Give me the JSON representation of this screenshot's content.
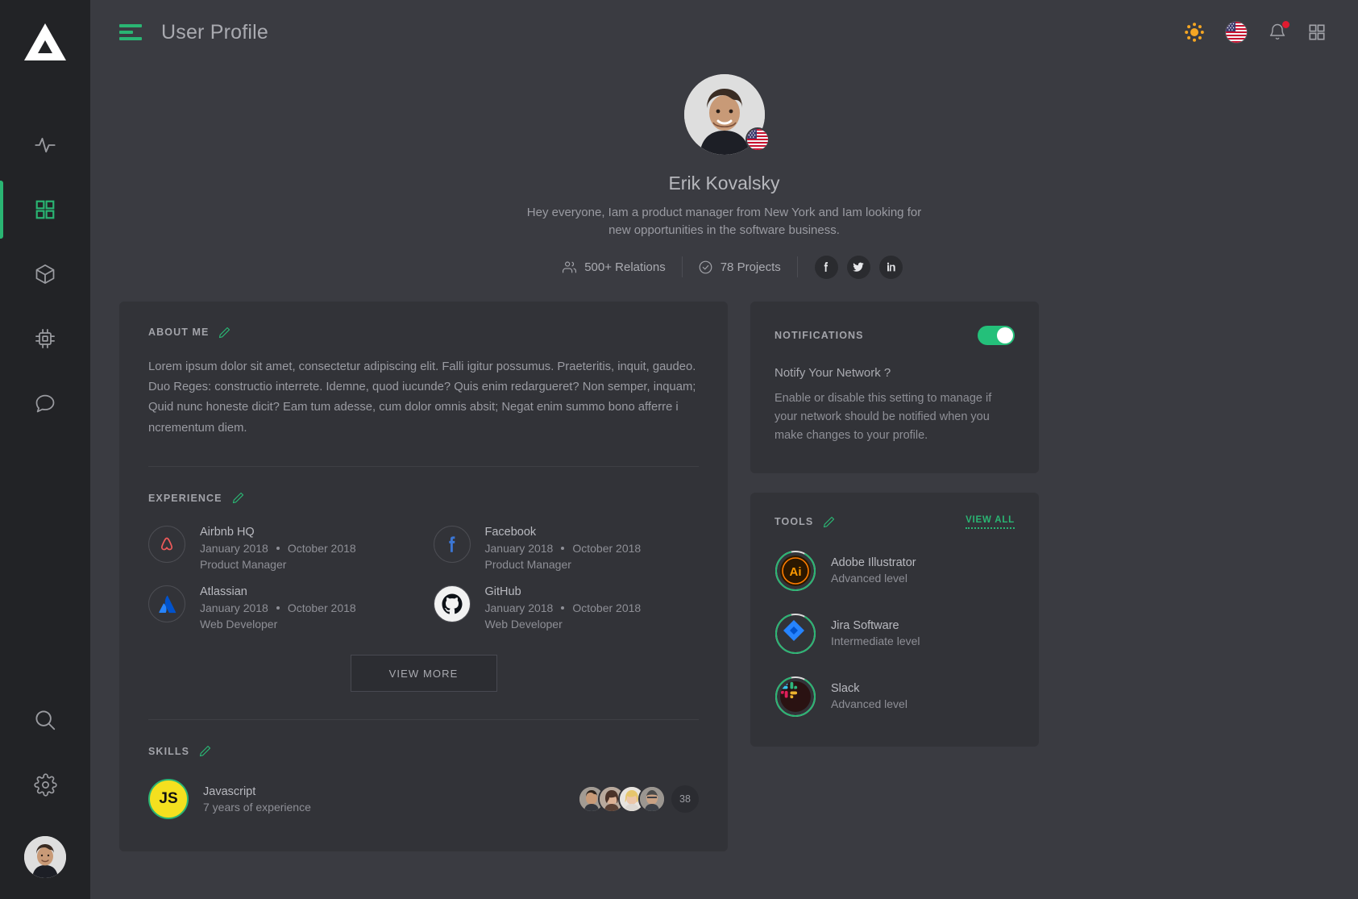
{
  "colors": {
    "accent": "#2ab573",
    "toggle_on": "#24c07a",
    "bg": "#3a3b41",
    "card": "#323338",
    "sidebar": "#222326",
    "notif_dot": "#e01b30",
    "sun": "#f5a623",
    "js_yellow": "#f4e01f"
  },
  "sidebar": {
    "logo_name": "triangle-logo",
    "items": [
      {
        "id": "activity",
        "icon": "activity-pulse-icon",
        "active": false
      },
      {
        "id": "dashboard",
        "icon": "grid-icon",
        "active": true
      },
      {
        "id": "packages",
        "icon": "cube-icon",
        "active": false
      },
      {
        "id": "hardware",
        "icon": "cpu-chip-icon",
        "active": false
      },
      {
        "id": "messages",
        "icon": "chat-bubble-icon",
        "active": false
      }
    ],
    "bottom_items": [
      {
        "id": "search",
        "icon": "search-icon"
      },
      {
        "id": "settings",
        "icon": "gear-icon"
      }
    ],
    "avatar_name": "sidebar-user-avatar"
  },
  "topbar": {
    "menu_icon": "hamburger-menu-icon",
    "title": "User Profile",
    "theme_icon": "sun-icon",
    "language_icon": "us-flag-icon",
    "notifications_icon": "bell-icon",
    "apps_icon": "apps-grid-icon",
    "has_notification": true
  },
  "profile": {
    "avatar_name": "profile-avatar",
    "country_flag": "us-flag-badge",
    "name": "Erik Kovalsky",
    "bio": "Hey everyone,  Iam a product manager from New York and Iam looking for new opportunities in the software business.",
    "stats": [
      {
        "icon": "users-icon",
        "label": "500+ Relations"
      },
      {
        "icon": "check-circle-icon",
        "label": "78 Projects"
      }
    ],
    "socials": [
      {
        "id": "facebook",
        "icon": "facebook-icon"
      },
      {
        "id": "twitter",
        "icon": "twitter-icon"
      },
      {
        "id": "linkedin",
        "icon": "linkedin-icon"
      }
    ]
  },
  "about": {
    "title": "ABOUT ME",
    "edit_icon": "pencil-edit-icon",
    "text": "Lorem ipsum dolor sit amet, consectetur adipiscing elit. Falli igitur possumus. Praeteritis, inquit, gaudeo. Duo Reges: constructio interrete. Idemne, quod iucunde? Quis enim redargueret? Non semper, inquam; Quid nunc honeste dicit? Eam tum adesse, cum dolor omnis absit; Negat enim summo bono afferre i ncrementum diem."
  },
  "experience": {
    "title": "EXPERIENCE",
    "edit_icon": "pencil-edit-icon",
    "items": [
      {
        "company": "Airbnb HQ",
        "logo": "airbnb-icon",
        "start": "January 2018",
        "end": "October 2018",
        "role": "Product Manager"
      },
      {
        "company": "Facebook",
        "logo": "facebook-icon",
        "start": "January 2018",
        "end": "October 2018",
        "role": "Product Manager"
      },
      {
        "company": "Atlassian",
        "logo": "atlassian-icon",
        "start": "January 2018",
        "end": "October 2018",
        "role": "Web Developer"
      },
      {
        "company": "GitHub",
        "logo": "github-icon",
        "start": "January 2018",
        "end": "October 2018",
        "role": "Web Developer"
      }
    ],
    "view_more_label": "VIEW MORE"
  },
  "skills": {
    "title": "SKILLS",
    "edit_icon": "pencil-edit-icon",
    "items": [
      {
        "badge": "JS",
        "name": "Javascript",
        "experience": "7 years of experience",
        "people_count": "38",
        "avatars": 4
      }
    ]
  },
  "notifications": {
    "title": "NOTIFICATIONS",
    "toggle_on": true,
    "question": "Notify Your Network ?",
    "description": "Enable or disable this setting to manage if your network should be notified when you make changes to your profile."
  },
  "tools": {
    "title": "TOOLS",
    "edit_icon": "pencil-edit-icon",
    "view_all_label": "VIEW ALL",
    "items": [
      {
        "name": "Adobe Illustrator",
        "level": "Advanced level",
        "icon": "adobe-illustrator-icon",
        "progress": 88
      },
      {
        "name": "Jira Software",
        "level": "Intermediate level",
        "icon": "jira-icon",
        "progress": 88
      },
      {
        "name": "Slack",
        "level": "Advanced level",
        "icon": "slack-icon",
        "progress": 88
      }
    ]
  }
}
